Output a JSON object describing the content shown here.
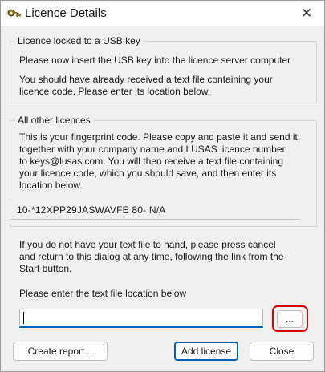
{
  "window": {
    "title": "Licence Details",
    "close_glyph": "✕",
    "app_icon": "key-icon"
  },
  "usb_group": {
    "legend": "Licence locked to a USB key",
    "line1": "Please now insert the USB key into the licence server computer",
    "line2": "You should have already received a text file containing your",
    "line3": "licence code. Please enter its location below."
  },
  "other_group": {
    "legend": "All other licences",
    "line1": "This is your fingerprint code. Please copy and paste it and send it,",
    "line2": "together with your company name and LUSAS licence number,",
    "line3": "to keys@lusas.com. You will then receive a text file containing",
    "line4": "your licence code, which you should save, and then enter its",
    "line5": "location below.",
    "fingerprint": "10-*12XPP29JASWAVFE 80- N/A"
  },
  "instructions": {
    "line1": "If you do not have your text file to hand, please press cancel",
    "line2": "and return to this dialog at any time, following the link from the",
    "line3": "Start button."
  },
  "file_prompt": "Please enter the text file location below",
  "file_input": {
    "value": "",
    "placeholder": ""
  },
  "buttons": {
    "browse": "...",
    "create_report": "Create report...",
    "add_license": "Add license",
    "close": "Close"
  },
  "colors": {
    "highlight": "#d40000",
    "accent": "#005fb8"
  }
}
